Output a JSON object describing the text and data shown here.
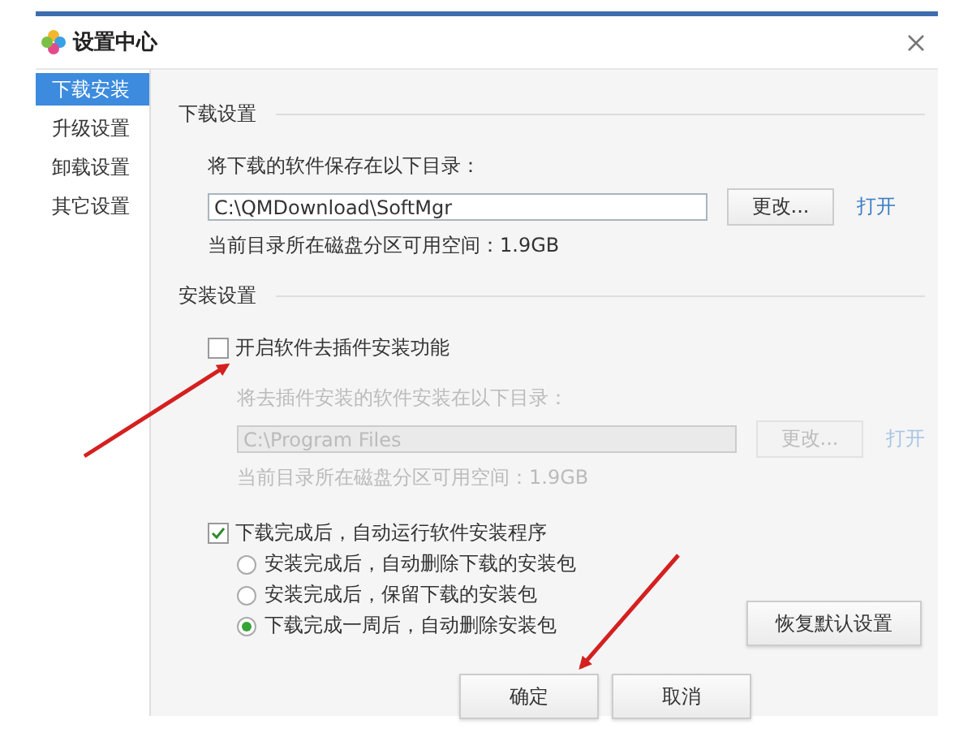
{
  "window": {
    "title": "设置中心"
  },
  "sidebar": {
    "items": [
      {
        "label": "下载安装",
        "selected": true
      },
      {
        "label": "升级设置",
        "selected": false
      },
      {
        "label": "卸载设置",
        "selected": false
      },
      {
        "label": "其它设置",
        "selected": false
      }
    ]
  },
  "download_settings": {
    "heading": "下载设置",
    "dir": {
      "disabled": false,
      "path_label": "将下载的软件保存在以下目录：",
      "path": "C:\\QMDownload\\SoftMgr",
      "change_button": "更改...",
      "open_link": "打开",
      "free_space": "当前目录所在磁盘分区可用空间：1.9GB"
    }
  },
  "install_settings": {
    "heading": "安装设置",
    "plugin_option": {
      "label": "开启软件去插件安装功能",
      "checked": false
    },
    "dir": {
      "disabled": true,
      "path_label": "将去插件安装的软件安装在以下目录：",
      "path": "C:\\Program Files",
      "change_button": "更改...",
      "open_link": "打开",
      "free_space": "当前目录所在磁盘分区可用空间：1.9GB"
    },
    "auto_install": {
      "label": "下载完成后，自动运行软件安装程序",
      "checked": true
    },
    "cleanup_options": [
      {
        "label": "安装完成后，自动删除下载的安装包",
        "selected": false
      },
      {
        "label": "安装完成后，保留下载的安装包",
        "selected": false
      },
      {
        "label": "下载完成一周后，自动删除安装包",
        "selected": true
      }
    ],
    "restore_button": "恢复默认设置"
  },
  "buttons": [
    {
      "label": "确定"
    },
    {
      "label": "取消"
    }
  ]
}
